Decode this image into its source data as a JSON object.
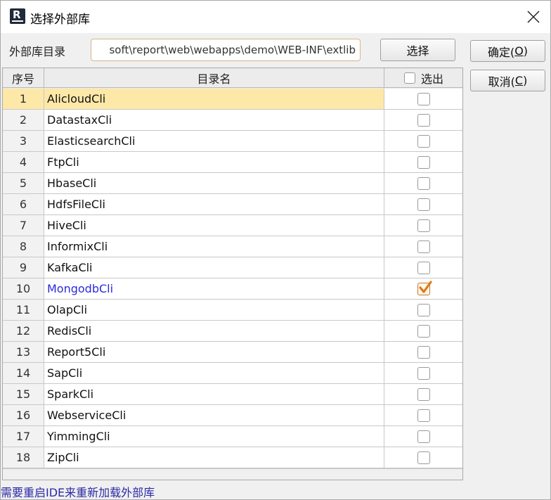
{
  "window": {
    "title": "选择外部库"
  },
  "form": {
    "dir_label": "外部库目录",
    "dir_value": "soft\\report\\web\\webapps\\demo\\WEB-INF\\extlib",
    "choose_label": "选择"
  },
  "actions": {
    "ok_text": "确定(",
    "ok_key": "O",
    "ok_tail": ")",
    "cancel_text": "取消(",
    "cancel_key": "C",
    "cancel_tail": ")"
  },
  "table": {
    "col_no": "序号",
    "col_name": "目录名",
    "col_select": "选出",
    "rows": [
      {
        "no": "1",
        "name": "AlicloudCli",
        "checked": false
      },
      {
        "no": "2",
        "name": "DatastaxCli",
        "checked": false
      },
      {
        "no": "3",
        "name": "ElasticsearchCli",
        "checked": false
      },
      {
        "no": "4",
        "name": "FtpCli",
        "checked": false
      },
      {
        "no": "5",
        "name": "HbaseCli",
        "checked": false
      },
      {
        "no": "6",
        "name": "HdfsFileCli",
        "checked": false
      },
      {
        "no": "7",
        "name": "HiveCli",
        "checked": false
      },
      {
        "no": "8",
        "name": "InformixCli",
        "checked": false
      },
      {
        "no": "9",
        "name": "KafkaCli",
        "checked": false
      },
      {
        "no": "10",
        "name": "MongodbCli",
        "checked": true
      },
      {
        "no": "11",
        "name": "OlapCli",
        "checked": false
      },
      {
        "no": "12",
        "name": "RedisCli",
        "checked": false
      },
      {
        "no": "13",
        "name": "Report5Cli",
        "checked": false
      },
      {
        "no": "14",
        "name": "SapCli",
        "checked": false
      },
      {
        "no": "15",
        "name": "SparkCli",
        "checked": false
      },
      {
        "no": "16",
        "name": "WebserviceCli",
        "checked": false
      },
      {
        "no": "17",
        "name": "YimmingCli",
        "checked": false
      },
      {
        "no": "18",
        "name": "ZipCli",
        "checked": false
      }
    ]
  },
  "footer": {
    "note": "需要重启IDE来重新加载外部库"
  },
  "colors": {
    "selected_row": "#fde8a8",
    "checked_row_text": "#2a2ae0",
    "note_text": "#2a2aa8"
  },
  "icons": {
    "app": "report-app-icon",
    "close": "close-icon",
    "check": "checkmark-icon"
  }
}
